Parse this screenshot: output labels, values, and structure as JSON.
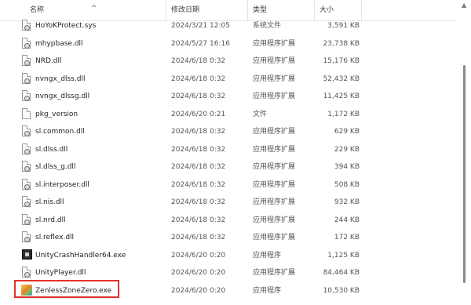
{
  "header": {
    "name": "名称",
    "date": "修改日期",
    "type": "类型",
    "size": "大小",
    "sort_indicator": "^"
  },
  "files": [
    {
      "name": "HoYoKProtect.sys",
      "date": "2024/3/21 12:05",
      "type": "系统文件",
      "size": "3,591 KB",
      "icon": "system-file-icon"
    },
    {
      "name": "mhypbase.dll",
      "date": "2024/5/27 16:16",
      "type": "应用程序扩展",
      "size": "23,738 KB",
      "icon": "dll-file-icon"
    },
    {
      "name": "NRD.dll",
      "date": "2024/6/18 0:32",
      "type": "应用程序扩展",
      "size": "15,176 KB",
      "icon": "dll-file-icon"
    },
    {
      "name": "nvngx_dlss.dll",
      "date": "2024/6/18 0:32",
      "type": "应用程序扩展",
      "size": "52,432 KB",
      "icon": "dll-file-icon"
    },
    {
      "name": "nvngx_dlssg.dll",
      "date": "2024/6/18 0:32",
      "type": "应用程序扩展",
      "size": "11,425 KB",
      "icon": "dll-file-icon"
    },
    {
      "name": "pkg_version",
      "date": "2024/6/20 0:21",
      "type": "文件",
      "size": "1,172 KB",
      "icon": "generic-file-icon"
    },
    {
      "name": "sl.common.dll",
      "date": "2024/6/18 0:32",
      "type": "应用程序扩展",
      "size": "629 KB",
      "icon": "dll-file-icon"
    },
    {
      "name": "sl.dlss.dll",
      "date": "2024/6/18 0:32",
      "type": "应用程序扩展",
      "size": "229 KB",
      "icon": "dll-file-icon"
    },
    {
      "name": "sl.dlss_g.dll",
      "date": "2024/6/18 0:32",
      "type": "应用程序扩展",
      "size": "394 KB",
      "icon": "dll-file-icon"
    },
    {
      "name": "sl.interposer.dll",
      "date": "2024/6/18 0:32",
      "type": "应用程序扩展",
      "size": "508 KB",
      "icon": "dll-file-icon"
    },
    {
      "name": "sl.nis.dll",
      "date": "2024/6/18 0:32",
      "type": "应用程序扩展",
      "size": "932 KB",
      "icon": "dll-file-icon"
    },
    {
      "name": "sl.nrd.dll",
      "date": "2024/6/18 0:32",
      "type": "应用程序扩展",
      "size": "244 KB",
      "icon": "dll-file-icon"
    },
    {
      "name": "sl.reflex.dll",
      "date": "2024/6/18 0:32",
      "type": "应用程序扩展",
      "size": "172 KB",
      "icon": "dll-file-icon"
    },
    {
      "name": "UnityCrashHandler64.exe",
      "date": "2024/6/20 0:20",
      "type": "应用程序",
      "size": "1,125 KB",
      "icon": "app-exe-icon"
    },
    {
      "name": "UnityPlayer.dll",
      "date": "2024/6/20 0:20",
      "type": "应用程序扩展",
      "size": "84,464 KB",
      "icon": "dll-file-icon"
    },
    {
      "name": "ZenlessZoneZero.exe",
      "date": "2024/6/20 0:20",
      "type": "应用程序",
      "size": "10,530 KB",
      "icon": "game-exe-icon",
      "highlighted": true
    }
  ],
  "colors": {
    "highlight_border": "#e0322b",
    "scroll_thumb": "#8a8a8a"
  }
}
